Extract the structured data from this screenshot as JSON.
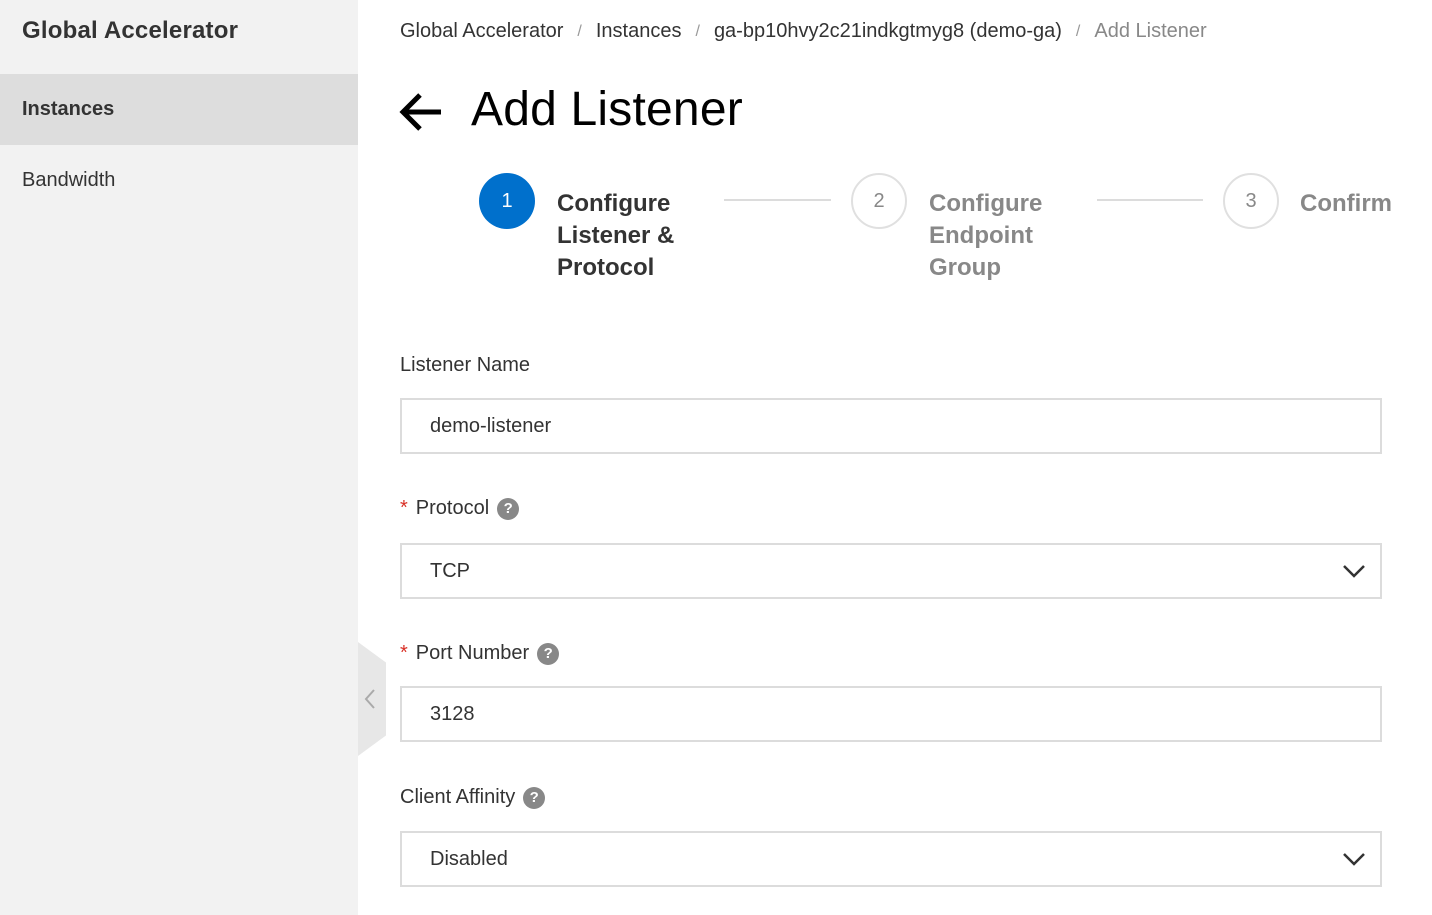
{
  "sidebar": {
    "title": "Global Accelerator",
    "items": [
      {
        "label": "Instances",
        "active": true
      },
      {
        "label": "Bandwidth",
        "active": false
      }
    ]
  },
  "breadcrumb": [
    {
      "label": "Global Accelerator"
    },
    {
      "label": "Instances"
    },
    {
      "label": "ga-bp10hvy2c21indkgtmyg8 (demo-ga)"
    },
    {
      "label": "Add Listener"
    }
  ],
  "breadcrumb_separator": "/",
  "page": {
    "title": "Add Listener"
  },
  "steps": [
    {
      "number": "1",
      "label_lines": [
        "Configure",
        "Listener &",
        "Protocol"
      ],
      "state": "active"
    },
    {
      "number": "2",
      "label_lines": [
        "Configure",
        "Endpoint",
        "Group"
      ],
      "state": "pending"
    },
    {
      "number": "3",
      "label_lines": [
        "Confirm"
      ],
      "state": "pending"
    }
  ],
  "form": {
    "listener_name": {
      "label": "Listener Name",
      "value": "demo-listener",
      "required": false
    },
    "protocol": {
      "label": "Protocol",
      "value": "TCP",
      "required": true
    },
    "port_number": {
      "label": "Port Number",
      "value": "3128",
      "required": true
    },
    "client_affinity": {
      "label": "Client Affinity",
      "value": "Disabled",
      "required": false
    },
    "required_marker": "*",
    "help_glyph": "?"
  },
  "colors": {
    "accent": "#0070cc",
    "required": "#d93026",
    "sidebar_bg": "#f2f2f2",
    "sidebar_active": "#dddddd"
  }
}
